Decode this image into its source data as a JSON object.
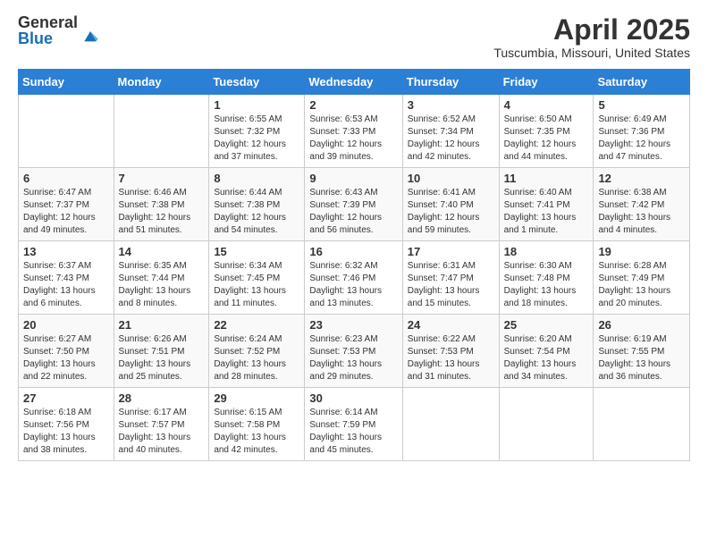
{
  "logo": {
    "general": "General",
    "blue": "Blue"
  },
  "title": "April 2025",
  "location": "Tuscumbia, Missouri, United States",
  "weekdays": [
    "Sunday",
    "Monday",
    "Tuesday",
    "Wednesday",
    "Thursday",
    "Friday",
    "Saturday"
  ],
  "weeks": [
    [
      {
        "day": "",
        "info": ""
      },
      {
        "day": "",
        "info": ""
      },
      {
        "day": "1",
        "info": "Sunrise: 6:55 AM\nSunset: 7:32 PM\nDaylight: 12 hours and 37 minutes."
      },
      {
        "day": "2",
        "info": "Sunrise: 6:53 AM\nSunset: 7:33 PM\nDaylight: 12 hours and 39 minutes."
      },
      {
        "day": "3",
        "info": "Sunrise: 6:52 AM\nSunset: 7:34 PM\nDaylight: 12 hours and 42 minutes."
      },
      {
        "day": "4",
        "info": "Sunrise: 6:50 AM\nSunset: 7:35 PM\nDaylight: 12 hours and 44 minutes."
      },
      {
        "day": "5",
        "info": "Sunrise: 6:49 AM\nSunset: 7:36 PM\nDaylight: 12 hours and 47 minutes."
      }
    ],
    [
      {
        "day": "6",
        "info": "Sunrise: 6:47 AM\nSunset: 7:37 PM\nDaylight: 12 hours and 49 minutes."
      },
      {
        "day": "7",
        "info": "Sunrise: 6:46 AM\nSunset: 7:38 PM\nDaylight: 12 hours and 51 minutes."
      },
      {
        "day": "8",
        "info": "Sunrise: 6:44 AM\nSunset: 7:38 PM\nDaylight: 12 hours and 54 minutes."
      },
      {
        "day": "9",
        "info": "Sunrise: 6:43 AM\nSunset: 7:39 PM\nDaylight: 12 hours and 56 minutes."
      },
      {
        "day": "10",
        "info": "Sunrise: 6:41 AM\nSunset: 7:40 PM\nDaylight: 12 hours and 59 minutes."
      },
      {
        "day": "11",
        "info": "Sunrise: 6:40 AM\nSunset: 7:41 PM\nDaylight: 13 hours and 1 minute."
      },
      {
        "day": "12",
        "info": "Sunrise: 6:38 AM\nSunset: 7:42 PM\nDaylight: 13 hours and 4 minutes."
      }
    ],
    [
      {
        "day": "13",
        "info": "Sunrise: 6:37 AM\nSunset: 7:43 PM\nDaylight: 13 hours and 6 minutes."
      },
      {
        "day": "14",
        "info": "Sunrise: 6:35 AM\nSunset: 7:44 PM\nDaylight: 13 hours and 8 minutes."
      },
      {
        "day": "15",
        "info": "Sunrise: 6:34 AM\nSunset: 7:45 PM\nDaylight: 13 hours and 11 minutes."
      },
      {
        "day": "16",
        "info": "Sunrise: 6:32 AM\nSunset: 7:46 PM\nDaylight: 13 hours and 13 minutes."
      },
      {
        "day": "17",
        "info": "Sunrise: 6:31 AM\nSunset: 7:47 PM\nDaylight: 13 hours and 15 minutes."
      },
      {
        "day": "18",
        "info": "Sunrise: 6:30 AM\nSunset: 7:48 PM\nDaylight: 13 hours and 18 minutes."
      },
      {
        "day": "19",
        "info": "Sunrise: 6:28 AM\nSunset: 7:49 PM\nDaylight: 13 hours and 20 minutes."
      }
    ],
    [
      {
        "day": "20",
        "info": "Sunrise: 6:27 AM\nSunset: 7:50 PM\nDaylight: 13 hours and 22 minutes."
      },
      {
        "day": "21",
        "info": "Sunrise: 6:26 AM\nSunset: 7:51 PM\nDaylight: 13 hours and 25 minutes."
      },
      {
        "day": "22",
        "info": "Sunrise: 6:24 AM\nSunset: 7:52 PM\nDaylight: 13 hours and 28 minutes."
      },
      {
        "day": "23",
        "info": "Sunrise: 6:23 AM\nSunset: 7:53 PM\nDaylight: 13 hours and 29 minutes."
      },
      {
        "day": "24",
        "info": "Sunrise: 6:22 AM\nSunset: 7:53 PM\nDaylight: 13 hours and 31 minutes."
      },
      {
        "day": "25",
        "info": "Sunrise: 6:20 AM\nSunset: 7:54 PM\nDaylight: 13 hours and 34 minutes."
      },
      {
        "day": "26",
        "info": "Sunrise: 6:19 AM\nSunset: 7:55 PM\nDaylight: 13 hours and 36 minutes."
      }
    ],
    [
      {
        "day": "27",
        "info": "Sunrise: 6:18 AM\nSunset: 7:56 PM\nDaylight: 13 hours and 38 minutes."
      },
      {
        "day": "28",
        "info": "Sunrise: 6:17 AM\nSunset: 7:57 PM\nDaylight: 13 hours and 40 minutes."
      },
      {
        "day": "29",
        "info": "Sunrise: 6:15 AM\nSunset: 7:58 PM\nDaylight: 13 hours and 42 minutes."
      },
      {
        "day": "30",
        "info": "Sunrise: 6:14 AM\nSunset: 7:59 PM\nDaylight: 13 hours and 45 minutes."
      },
      {
        "day": "",
        "info": ""
      },
      {
        "day": "",
        "info": ""
      },
      {
        "day": "",
        "info": ""
      }
    ]
  ]
}
